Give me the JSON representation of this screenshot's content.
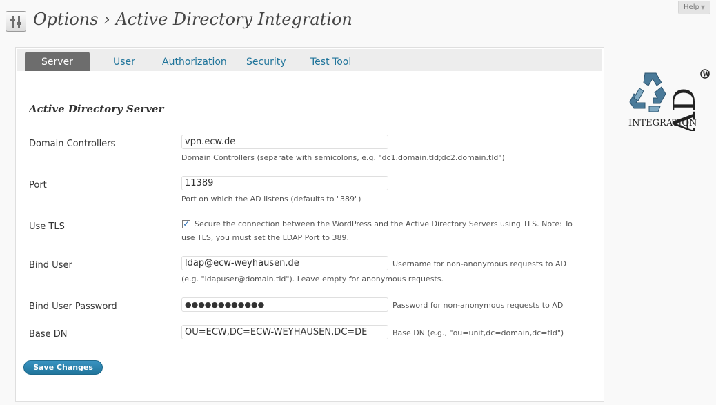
{
  "header": {
    "title": "Options › Active Directory Integration",
    "help_label": "Help",
    "help_arrow": "▼"
  },
  "tabs": [
    {
      "label": "Server",
      "active": true
    },
    {
      "label": "User",
      "active": false
    },
    {
      "label": "Authorization",
      "active": false
    },
    {
      "label": "Security",
      "active": false
    },
    {
      "label": "Test Tool",
      "active": false
    }
  ],
  "section": {
    "title": "Active Directory Server"
  },
  "fields": {
    "domain_controllers": {
      "label": "Domain Controllers",
      "value": "vpn.ecw.de",
      "description": "Domain Controllers (separate with semicolons, e.g. \"dc1.domain.tld;dc2.domain.tld\")"
    },
    "port": {
      "label": "Port",
      "value": "11389",
      "description": "Port on which the AD listens (defaults to \"389\")"
    },
    "use_tls": {
      "label": "Use TLS",
      "checked": true,
      "description_line1": "Secure the connection between the WordPress and the Active Directory Servers using TLS. Note: To",
      "description_line2": "use TLS, you must set the LDAP Port to 389."
    },
    "bind_user": {
      "label": "Bind User",
      "value": "ldap@ecw-weyhausen.de",
      "description_inline": "Username for non-anonymous requests to AD",
      "description_line2": "(e.g. \"ldapuser@domain.tld\"). Leave empty for anonymous requests."
    },
    "bind_user_password": {
      "label": "Bind User Password",
      "value": "●●●●●●●●●●●●",
      "description": "Password for non-anonymous requests to AD"
    },
    "base_dn": {
      "label": "Base DN",
      "value": "OU=ECW,DC=ECW-WEYHAUSEN,DC=DE",
      "description": "Base DN (e.g., \"ou=unit,dc=domain,dc=tld\")"
    }
  },
  "save_button": {
    "label": "Save Changes"
  },
  "logo": {
    "text_ad": "AD",
    "text_integration": "INTEGRATION",
    "icon": "recycle-arrows-icon"
  },
  "colors": {
    "link": "#21759b",
    "active_tab": "#6d6d6d",
    "button": "#21759b"
  }
}
